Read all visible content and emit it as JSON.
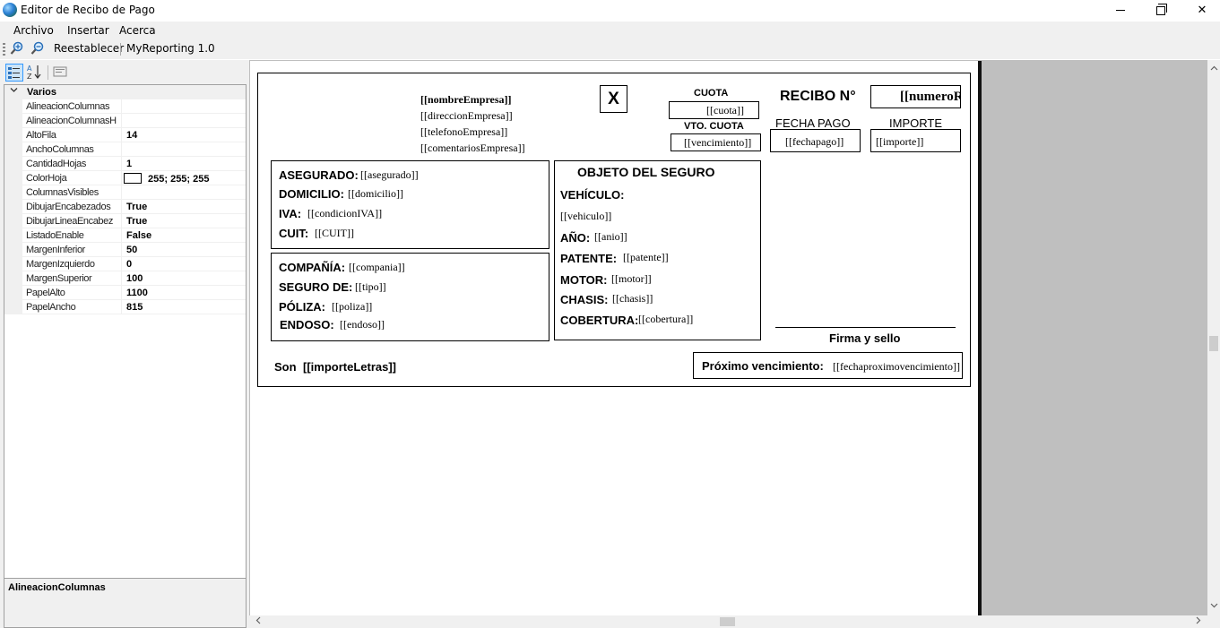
{
  "window": {
    "title": "Editor de Recibo de Pago"
  },
  "menu": {
    "items": [
      "Archivo",
      "Insertar",
      "Acerca"
    ]
  },
  "toolbar": {
    "reset_label": "Reestablecer",
    "brand_label": "MyReporting 1.0"
  },
  "property_grid": {
    "category": "Varios",
    "rows": [
      {
        "name": "AlineacionColumnas",
        "value": ""
      },
      {
        "name": "AlineacionColumnasH",
        "value": ""
      },
      {
        "name": "AltoFila",
        "value": "14"
      },
      {
        "name": "AnchoColumnas",
        "value": ""
      },
      {
        "name": "CantidadHojas",
        "value": "1"
      },
      {
        "name": "ColorHoja",
        "value": "255; 255; 255"
      },
      {
        "name": "ColumnasVisibles",
        "value": ""
      },
      {
        "name": "DibujarEncabezados",
        "value": "True"
      },
      {
        "name": "DibujarLineaEncabez",
        "value": "True"
      },
      {
        "name": "ListadoEnable",
        "value": "False"
      },
      {
        "name": "MargenInferior",
        "value": "50"
      },
      {
        "name": "MargenIzquierdo",
        "value": "0"
      },
      {
        "name": "MargenSuperior",
        "value": "100"
      },
      {
        "name": "PapelAlto",
        "value": "1100"
      },
      {
        "name": "PapelAncho",
        "value": "815"
      }
    ],
    "description_title": "AlineacionColumnas"
  },
  "receipt": {
    "empresa": {
      "nombre": "[[nombreEmpresa]]",
      "direccion": "[[direccionEmpresa]]",
      "telefono": "[[telefonoEmpresa]]",
      "comentarios": "[[comentariosEmpresa]]"
    },
    "x_mark": "X",
    "cuota_label": "CUOTA",
    "cuota_value": "[[cuota]]",
    "vto_label": "VTO. CUOTA",
    "vto_value": "[[vencimiento]]",
    "recibo_label": "RECIBO N°",
    "recibo_value": "[[numeroRecibo]]",
    "fecha_pago_label": "FECHA PAGO",
    "fecha_pago_value": "[[fechapago]]",
    "importe_label": "IMPORTE",
    "importe_value": "[[importe]]",
    "asegurado": {
      "asegurado_label": "ASEGURADO:",
      "asegurado_value": "[[asegurado]]",
      "domicilio_label": "DOMICILIO:",
      "domicilio_value": "[[domicilio]]",
      "iva_label": "IVA:",
      "iva_value": "[[condicionIVA]]",
      "cuit_label": "CUIT:",
      "cuit_value": "[[CUIT]]"
    },
    "compania": {
      "compania_label": "COMPAÑÍA:",
      "compania_value": "[[compania]]",
      "seguro_label": "SEGURO DE:",
      "seguro_value": "[[tipo]]",
      "poliza_label": "PÓLIZA:",
      "poliza_value": "[[poliza]]",
      "endoso_label": "ENDOSO:",
      "endoso_value": "[[endoso]]"
    },
    "objeto": {
      "title": "OBJETO DEL SEGURO",
      "vehiculo_label": "VEHÍCULO:",
      "vehiculo_value": "[[vehiculo]]",
      "anio_label": "AÑO:",
      "anio_value": "[[anio]]",
      "patente_label": "PATENTE:",
      "patente_value": "[[patente]]",
      "motor_label": "MOTOR:",
      "motor_value": "[[motor]]",
      "chasis_label": "CHASIS:",
      "chasis_value": "[[chasis]]",
      "cobertura_label": "COBERTURA:",
      "cobertura_value": "[[cobertura]]"
    },
    "firma_label": "Firma y sello",
    "son_label": "Son",
    "son_value": "[[importeLetras]]",
    "proximo_label": "Próximo vencimiento:",
    "proximo_value": "[[fechaproximovencimiento]]"
  }
}
